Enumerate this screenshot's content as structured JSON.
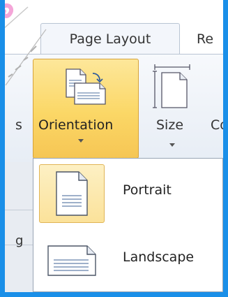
{
  "tabs": {
    "active_label": "Page Layout",
    "next_label": "Re"
  },
  "ribbon": {
    "left_cut_label": "s",
    "orientation_label": "Orientation",
    "size_label": "Size",
    "right_cut_label": "Co"
  },
  "side": {
    "cut_text": "g"
  },
  "menu": {
    "items": [
      {
        "label": "Portrait",
        "icon": "portrait-page-icon"
      },
      {
        "label": "Landscape",
        "icon": "landscape-page-icon"
      }
    ]
  },
  "colors": {
    "frame": "#1a8fe8",
    "highlight": "#fbd766",
    "menu_border": "#9aa6b6"
  }
}
